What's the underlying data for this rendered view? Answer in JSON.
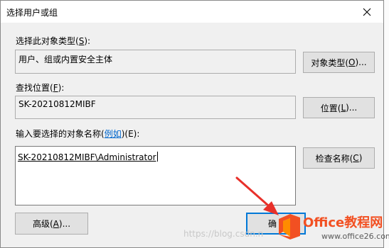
{
  "dialog": {
    "title": "选择用户或组",
    "object_type_label": "选择此对象类型(",
    "object_type_key": "S",
    "object_type_suffix": "):",
    "object_type_value": "用户、组或内置安全主体",
    "object_types_btn": "对象类型(",
    "object_types_btn_key": "O",
    "object_types_btn_suffix": ")...",
    "location_label": "查找位置(",
    "location_key": "F",
    "location_suffix": "):",
    "location_value": "SK-20210812MIBF",
    "locations_btn": "位置(",
    "locations_btn_key": "L",
    "locations_btn_suffix": ")...",
    "names_label": "输入要选择的对象名称(",
    "names_example": "例如",
    "names_suffix": ")(E):",
    "names_value": "SK-20210812MIBF\\Administrator",
    "check_names_btn": "检查名称(",
    "check_names_btn_key": "C",
    "check_names_btn_suffix": ")",
    "advanced_btn": "高级(",
    "advanced_btn_key": "A",
    "advanced_btn_suffix": ")...",
    "ok_btn": "确"
  },
  "watermark": "https://blog.csdn.n",
  "logo": {
    "brand": "Office教程网",
    "url": "www.office26.com",
    "colors": [
      "#f25022",
      "#ff8c00"
    ]
  },
  "colors": {
    "window_bg": "#f0f0f0",
    "titlebar_bg": "#ffffff",
    "arrow": "#e8302a",
    "primary_border": "#0078d7"
  }
}
